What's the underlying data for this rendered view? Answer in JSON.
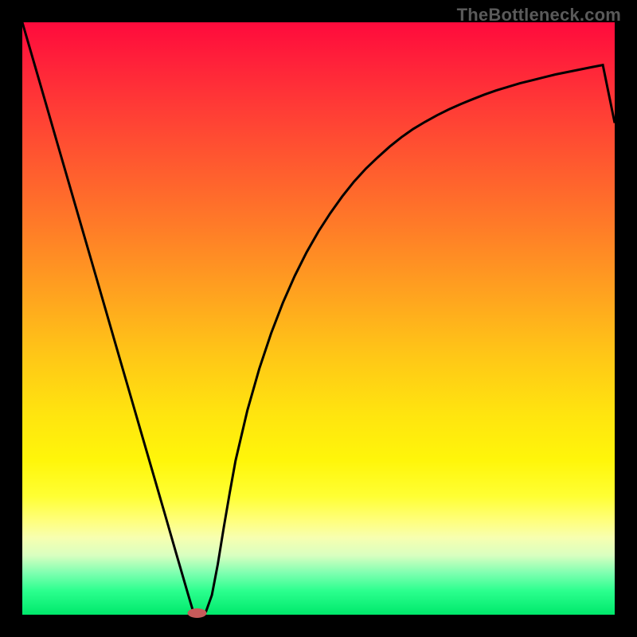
{
  "watermark": {
    "text": "TheBottleneck.com"
  },
  "chart_data": {
    "type": "line",
    "title": "",
    "xlabel": "",
    "ylabel": "",
    "xlim": [
      0,
      100
    ],
    "ylim": [
      0,
      100
    ],
    "x": [
      0,
      2,
      4,
      6,
      8,
      10,
      12,
      14,
      16,
      18,
      20,
      22,
      24,
      26,
      28,
      29,
      30,
      31,
      32,
      33,
      34,
      35,
      36,
      38,
      40,
      42,
      44,
      46,
      48,
      50,
      52,
      54,
      56,
      58,
      60,
      62,
      64,
      66,
      68,
      70,
      72,
      74,
      76,
      78,
      80,
      82,
      84,
      86,
      88,
      90,
      92,
      94,
      96,
      98,
      100
    ],
    "y": [
      100,
      93.1,
      86.2,
      79.3,
      72.4,
      65.5,
      58.6,
      51.7,
      44.8,
      37.9,
      31.0,
      24.1,
      17.2,
      10.3,
      3.4,
      0,
      0,
      0.5,
      3.3,
      8.5,
      14.7,
      20.5,
      26.0,
      34.5,
      41.5,
      47.5,
      52.7,
      57.2,
      61.2,
      64.7,
      67.8,
      70.6,
      73.1,
      75.3,
      77.2,
      79.0,
      80.6,
      82.0,
      83.2,
      84.3,
      85.3,
      86.2,
      87.0,
      87.8,
      88.5,
      89.1,
      89.7,
      90.2,
      90.7,
      91.2,
      91.6,
      92.0,
      92.4,
      92.8,
      83.0
    ],
    "minimum": {
      "x": 29.5,
      "y": 0
    },
    "gradient_scale": {
      "top_value": 100,
      "bottom_value": 0,
      "top_color": "red",
      "bottom_color": "green"
    }
  }
}
